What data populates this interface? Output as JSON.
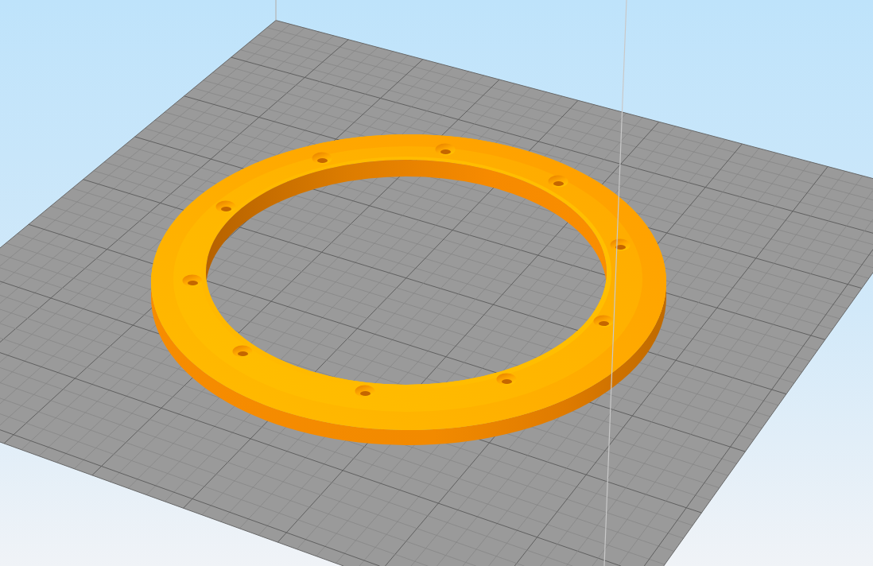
{
  "viewport": {
    "items": [
      {
        "kind": "bed"
      },
      {
        "kind": "model"
      },
      {
        "kind": "build-volume"
      }
    ]
  }
}
